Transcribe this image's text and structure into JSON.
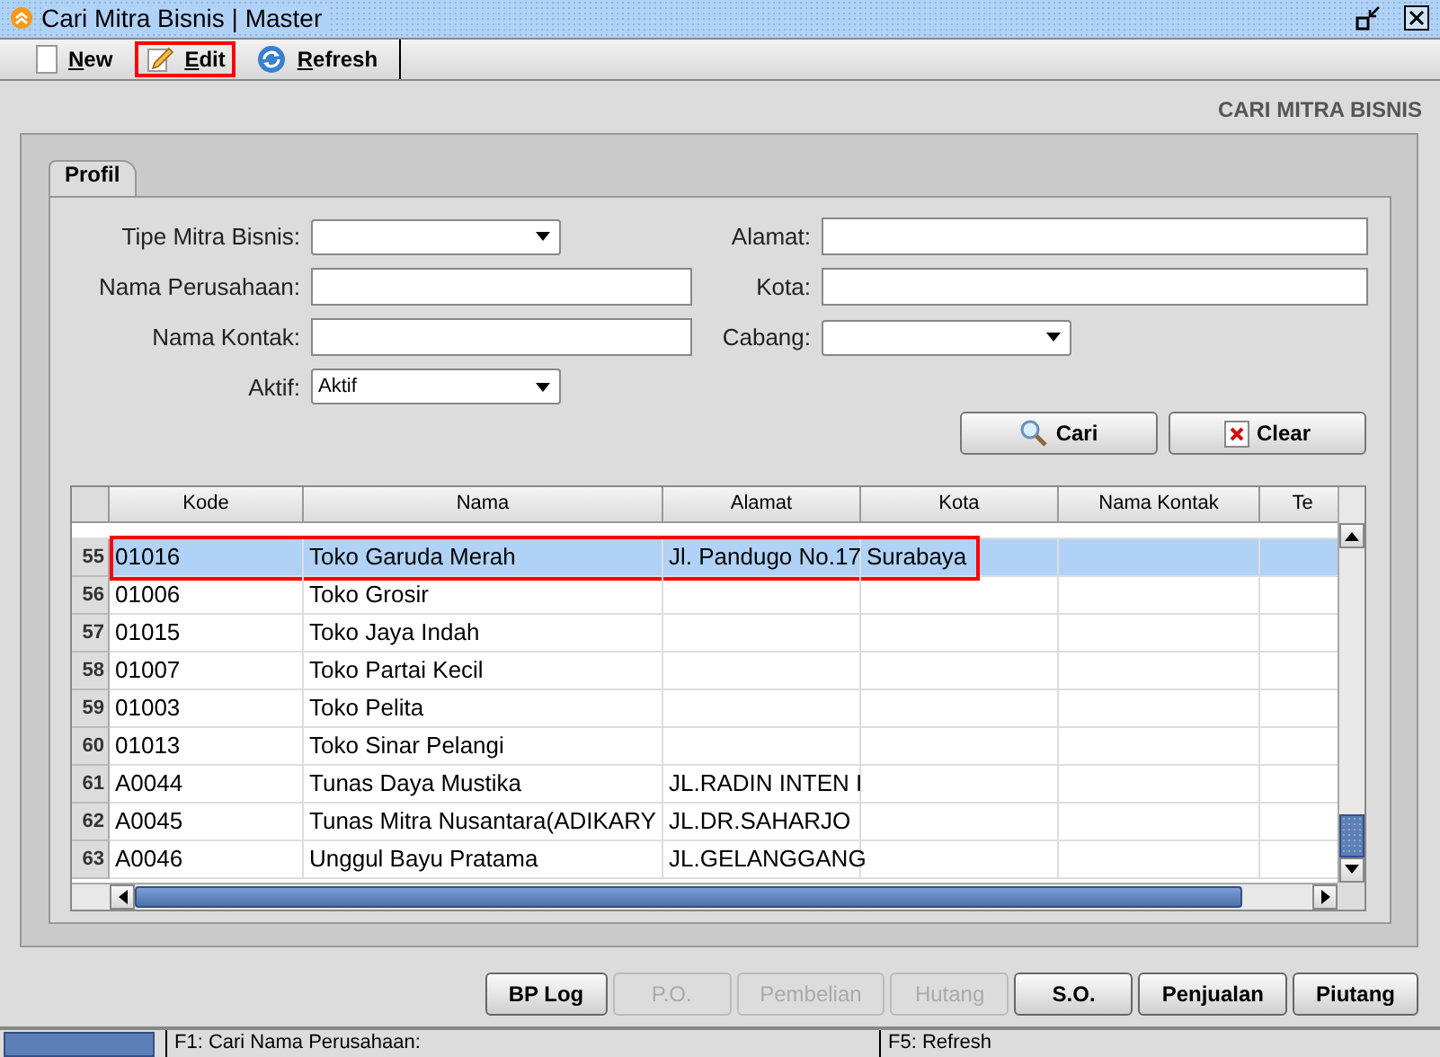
{
  "window": {
    "title": "Cari Mitra Bisnis | Master"
  },
  "toolbar": [
    {
      "label": "New",
      "kind": "new",
      "highlighted": false
    },
    {
      "label": "Edit",
      "kind": "edit",
      "highlighted": true
    },
    {
      "label": "Refresh",
      "kind": "refresh",
      "highlighted": false
    }
  ],
  "page_heading": "CARI MITRA BISNIS",
  "tabs": [
    {
      "label": "Profil",
      "selected": true
    }
  ],
  "form": {
    "fields": [
      {
        "label": "Tipe Mitra Bisnis:",
        "kind": "select"
      },
      {
        "label": "Alamat:",
        "kind": "text"
      },
      {
        "label": "Nama Perusahaan:",
        "kind": "text"
      },
      {
        "label": "Kota:",
        "kind": "text"
      },
      {
        "label": "Nama Kontak:",
        "kind": "text"
      },
      {
        "label": "Cabang:",
        "kind": "select"
      },
      {
        "label": "Aktif:",
        "kind": "select",
        "value": "Aktif"
      }
    ],
    "buttons": [
      {
        "label": "Cari",
        "kind": "search"
      },
      {
        "label": "Clear",
        "kind": "clear"
      }
    ]
  },
  "table": {
    "columns": [
      "Kode",
      "Nama",
      "Alamat",
      "Kota",
      "Nama Kontak",
      "Te"
    ],
    "rows": [
      {
        "number": "55",
        "kode": "01016",
        "nama": "Toko Garuda Merah",
        "alamat": "Jl. Pandugo No.17",
        "kota": "Surabaya",
        "selected": true,
        "highlighted": true
      },
      {
        "number": "56",
        "kode": "01006",
        "nama": "Toko Grosir",
        "selected": false,
        "highlighted": false
      },
      {
        "number": "57",
        "kode": "01015",
        "nama": "Toko Jaya Indah",
        "selected": false,
        "highlighted": false
      },
      {
        "number": "58",
        "kode": "01007",
        "nama": "Toko Partai Kecil",
        "selected": false,
        "highlighted": false
      },
      {
        "number": "59",
        "kode": "01003",
        "nama": "Toko Pelita",
        "selected": false,
        "highlighted": false
      },
      {
        "number": "60",
        "kode": "01013",
        "nama": "Toko Sinar Pelangi",
        "selected": false,
        "highlighted": false
      },
      {
        "number": "61",
        "kode": "A0044",
        "nama": "Tunas Daya Mustika",
        "alamat": "JL.RADIN INTEN I",
        "selected": false,
        "highlighted": false
      },
      {
        "number": "62",
        "kode": "A0045",
        "nama": "Tunas Mitra Nusantara(ADIKARY",
        "alamat": "JL.DR.SAHARJO",
        "selected": false,
        "highlighted": false
      },
      {
        "number": "63",
        "kode": "A0046",
        "nama": "Unggul Bayu Pratama",
        "alamat": "JL.GELANGGANG",
        "selected": false,
        "highlighted": false
      }
    ]
  },
  "bottom_buttons": [
    {
      "label": "BP Log",
      "disabled": false
    },
    {
      "label": "P.O.",
      "disabled": true
    },
    {
      "label": "Pembelian",
      "disabled": true
    },
    {
      "label": "Hutang",
      "disabled": true
    },
    {
      "label": "S.O.",
      "disabled": false
    },
    {
      "label": "Penjualan",
      "disabled": false
    },
    {
      "label": "Piutang",
      "disabled": false
    }
  ],
  "progress": {
    "level": 1
  },
  "status_bar": [
    "F1: Cari Nama Perusahaan:",
    "F5: Refresh"
  ]
}
